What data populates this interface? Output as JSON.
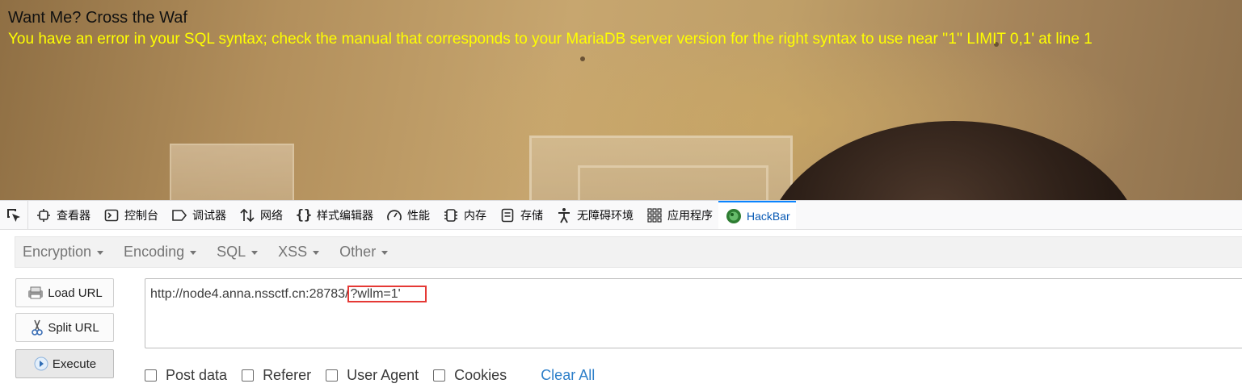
{
  "page": {
    "title": "Want Me? Cross the Waf",
    "error": "You have an error in your SQL syntax; check the manual that corresponds to your MariaDB server version for the right syntax to use near ''1'' LIMIT 0,1' at line 1"
  },
  "devtools": {
    "tabs": [
      {
        "label": "查看器",
        "icon": "inspector-icon"
      },
      {
        "label": "控制台",
        "icon": "console-icon"
      },
      {
        "label": "调试器",
        "icon": "debugger-icon"
      },
      {
        "label": "网络",
        "icon": "network-icon"
      },
      {
        "label": "样式编辑器",
        "icon": "style-editor-icon"
      },
      {
        "label": "性能",
        "icon": "performance-icon"
      },
      {
        "label": "内存",
        "icon": "memory-icon"
      },
      {
        "label": "存储",
        "icon": "storage-icon"
      },
      {
        "label": "无障碍环境",
        "icon": "accessibility-icon"
      },
      {
        "label": "应用程序",
        "icon": "application-icon"
      },
      {
        "label": "HackBar",
        "icon": "hackbar-icon",
        "selected": true
      }
    ],
    "accent": "#0a84ff"
  },
  "hackbar": {
    "menu": [
      "Encryption",
      "Encoding",
      "SQL",
      "XSS",
      "Other"
    ],
    "buttons": {
      "load_url": "Load URL",
      "split_url": "Split URL",
      "execute": "Execute"
    },
    "url_base": "http://node4.anna.nssctf.cn:28783/",
    "url_query": "?wllm=1'",
    "options": [
      "Post data",
      "Referer",
      "User Agent",
      "Cookies"
    ],
    "clear_all": "Clear All",
    "highlight_color": "#e53935"
  }
}
